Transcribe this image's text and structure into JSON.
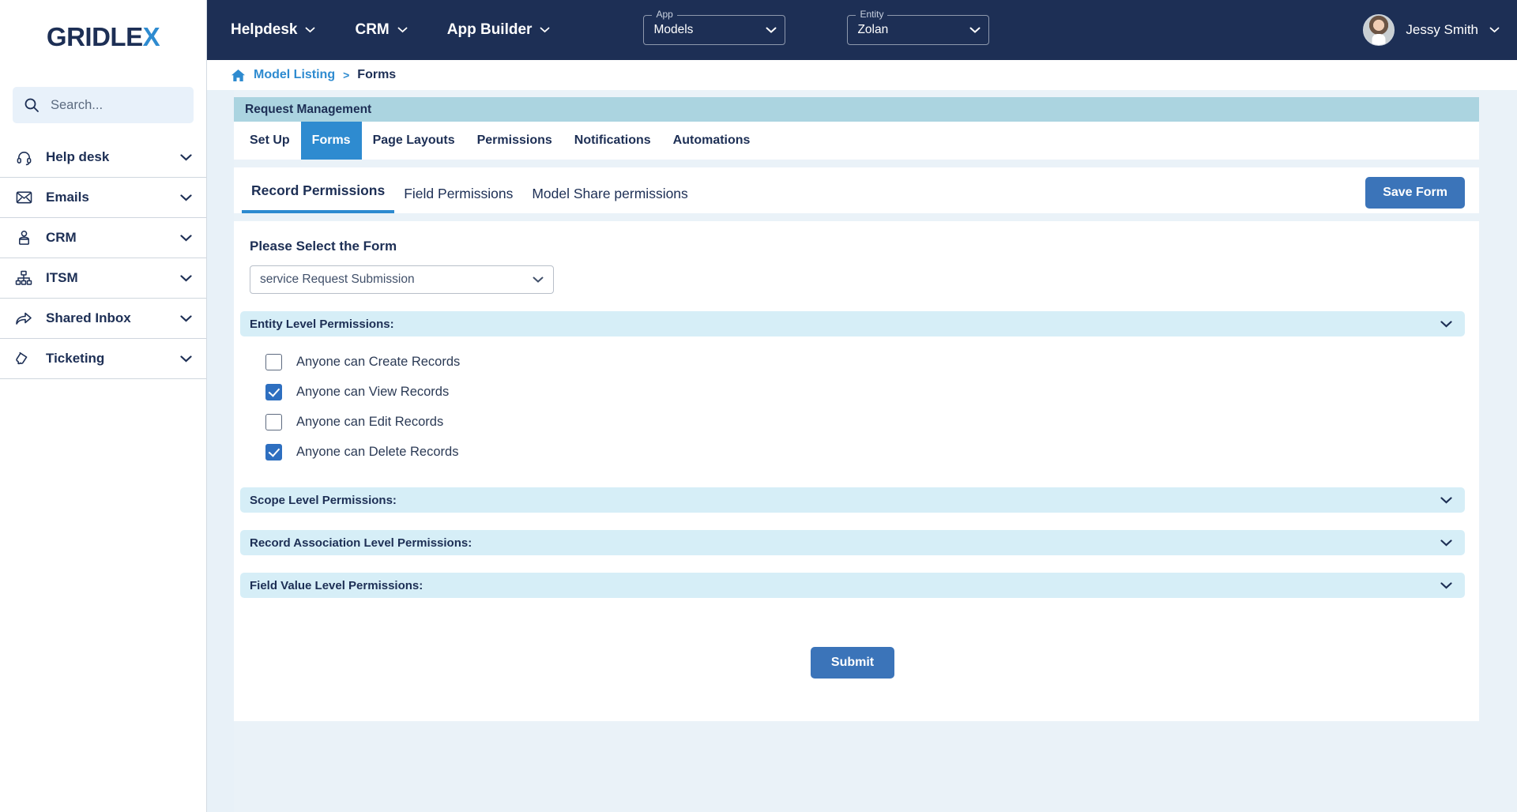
{
  "brand": {
    "logo_text_1": "GRIDLE",
    "logo_text_2": "X",
    "accent": "#2e8bd0",
    "navy": "#1d2f55"
  },
  "sidebar": {
    "search": {
      "placeholder": "Search...",
      "icon": "search-icon"
    },
    "items": [
      {
        "label": "Help desk",
        "icon": "headset-icon"
      },
      {
        "label": "Emails",
        "icon": "envelope-icon"
      },
      {
        "label": "CRM",
        "icon": "person-badge-icon"
      },
      {
        "label": "ITSM",
        "icon": "org-chart-icon"
      },
      {
        "label": "Shared Inbox",
        "icon": "share-arrow-icon"
      },
      {
        "label": "Ticketing",
        "icon": "ticket-icon"
      }
    ]
  },
  "topbar": {
    "nav": [
      {
        "label": "Helpdesk"
      },
      {
        "label": "CRM"
      },
      {
        "label": "App Builder"
      }
    ],
    "app_select": {
      "label": "App",
      "value": "Models"
    },
    "entity_select": {
      "label": "Entity",
      "value": "Zolan"
    },
    "user": {
      "name": "Jessy Smith"
    }
  },
  "breadcrumb": {
    "home_icon": "home-icon",
    "link": "Model Listing",
    "separator": ">",
    "current": "Forms"
  },
  "card": {
    "title": "Request Management",
    "tabs": [
      {
        "label": "Set Up",
        "active": false
      },
      {
        "label": "Forms",
        "active": true
      },
      {
        "label": "Page Layouts",
        "active": false
      },
      {
        "label": "Permissions",
        "active": false
      },
      {
        "label": "Notifications",
        "active": false
      },
      {
        "label": "Automations",
        "active": false
      }
    ]
  },
  "panel": {
    "subtabs": [
      {
        "label": "Record Permissions",
        "active": true
      },
      {
        "label": "Field Permissions",
        "active": false
      },
      {
        "label": "Model Share permissions",
        "active": false
      }
    ],
    "save_form_label": "Save Form"
  },
  "form": {
    "select_label": "Please Select the Form",
    "select_value": "service Request Submission",
    "sections": [
      {
        "title": "Entity Level Permissions:",
        "expanded": true
      },
      {
        "title": "Scope Level Permissions:",
        "expanded": false
      },
      {
        "title": "Record Association Level Permissions:",
        "expanded": false
      },
      {
        "title": "Field Value Level Permissions:",
        "expanded": false
      }
    ],
    "entity_permissions": [
      {
        "label": "Anyone can Create Records",
        "checked": false
      },
      {
        "label": "Anyone can View Records",
        "checked": true
      },
      {
        "label": "Anyone can Edit Records",
        "checked": false
      },
      {
        "label": "Anyone can Delete Records",
        "checked": true
      }
    ],
    "submit_label": "Submit"
  }
}
